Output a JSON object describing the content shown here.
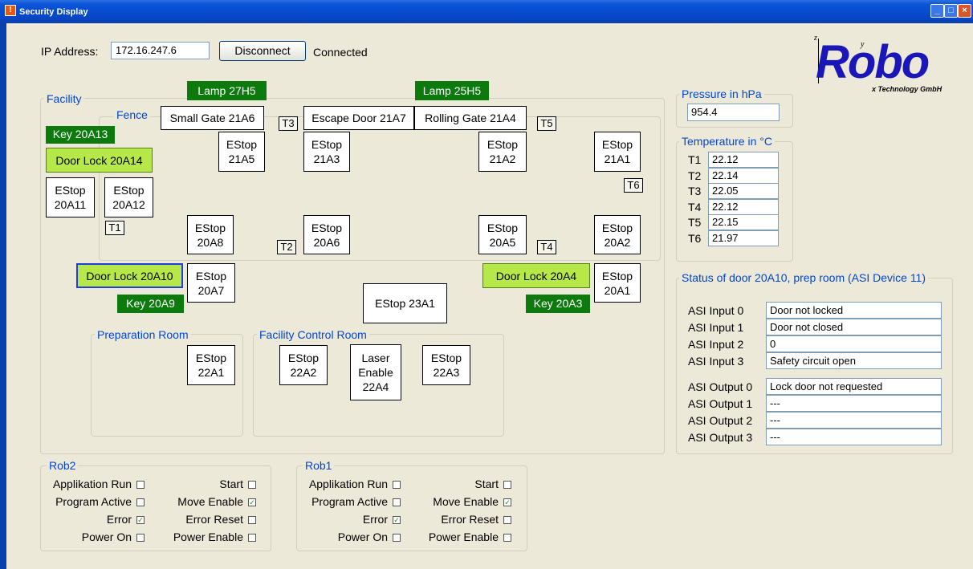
{
  "window": {
    "title": "Security Display",
    "app_icon": "warning-icon"
  },
  "connection": {
    "ip_label": "IP Address:",
    "ip_value": "172.16.247.6",
    "disconnect_label": "Disconnect",
    "status": "Connected"
  },
  "logo": {
    "brand": "Robo",
    "tagline": "x Technology GmbH",
    "axis_z": "z",
    "axis_y": "y"
  },
  "facility": {
    "label": "Facility",
    "fence_label": "Fence",
    "lamps": {
      "lamp_27h5": "Lamp 27H5",
      "lamp_25h5": "Lamp 25H5"
    },
    "gates": {
      "small_gate": "Small Gate 21A6",
      "escape_door": "Escape Door 21A7",
      "rolling_gate": "Rolling Gate 21A4"
    },
    "keys": {
      "key_20a13": "Key 20A13",
      "key_20a9": "Key 20A9",
      "key_20a3": "Key 20A3"
    },
    "door_locks": {
      "dl_20a14": "Door Lock 20A14",
      "dl_20a10": "Door Lock 20A10",
      "dl_20a4": "Door Lock 20A4"
    },
    "estops": {
      "e21a5": [
        "EStop",
        "21A5"
      ],
      "e21a3": [
        "EStop",
        "21A3"
      ],
      "e21a2": [
        "EStop",
        "21A2"
      ],
      "e21a1": [
        "EStop",
        "21A1"
      ],
      "e20a11": [
        "EStop",
        "20A11"
      ],
      "e20a12": [
        "EStop",
        "20A12"
      ],
      "e20a8": [
        "EStop",
        "20A8"
      ],
      "e20a6": [
        "EStop",
        "20A6"
      ],
      "e20a5": [
        "EStop",
        "20A5"
      ],
      "e20a2": [
        "EStop",
        "20A2"
      ],
      "e20a7": [
        "EStop",
        "20A7"
      ],
      "e20a1": [
        "EStop",
        "20A1"
      ],
      "e23a1": "EStop 23A1",
      "e22a1": [
        "EStop",
        "22A1"
      ],
      "e22a2": [
        "EStop",
        "22A2"
      ],
      "e22a3": [
        "EStop",
        "22A3"
      ]
    },
    "laser": [
      "Laser",
      "Enable",
      "22A4"
    ],
    "sensors": {
      "t1": "T1",
      "t2": "T2",
      "t3": "T3",
      "t4": "T4",
      "t5": "T5",
      "t6": "T6"
    },
    "prep_room_label": "Preparation Room",
    "control_room_label": "Facility Control Room"
  },
  "pressure": {
    "label": "Pressure in hPa",
    "value": "954.4"
  },
  "temperature": {
    "label": "Temperature in °C",
    "rows": [
      {
        "name": "T1",
        "value": "22.12"
      },
      {
        "name": "T2",
        "value": "22.14"
      },
      {
        "name": "T3",
        "value": "22.05"
      },
      {
        "name": "T4",
        "value": "22.12"
      },
      {
        "name": "T5",
        "value": "22.15"
      },
      {
        "name": "T6",
        "value": "21.97"
      }
    ]
  },
  "door_status": {
    "label": "Status of door 20A10, prep room (ASI Device 11)",
    "inputs": [
      {
        "name": "ASI Input 0",
        "value": "Door not locked"
      },
      {
        "name": "ASI Input 1",
        "value": "Door not closed"
      },
      {
        "name": "ASI Input 2",
        "value": "0"
      },
      {
        "name": "ASI Input 3",
        "value": "Safety circuit open"
      }
    ],
    "outputs": [
      {
        "name": "ASI Output 0",
        "value": "Lock door not requested"
      },
      {
        "name": "ASI Output 1",
        "value": "---"
      },
      {
        "name": "ASI Output 2",
        "value": "---"
      },
      {
        "name": "ASI Output 3",
        "value": "---"
      }
    ]
  },
  "rob2": {
    "label": "Rob2",
    "left": [
      {
        "label": "Applikation Run",
        "checked": false
      },
      {
        "label": "Program Active",
        "checked": false
      },
      {
        "label": "Error",
        "checked": true
      },
      {
        "label": "Power On",
        "checked": false
      }
    ],
    "right": [
      {
        "label": "Start",
        "checked": false
      },
      {
        "label": "Move Enable",
        "checked": true
      },
      {
        "label": "Error Reset",
        "checked": false
      },
      {
        "label": "Power Enable",
        "checked": false
      }
    ]
  },
  "rob1": {
    "label": "Rob1",
    "left": [
      {
        "label": "Applikation Run",
        "checked": false
      },
      {
        "label": "Program Active",
        "checked": false
      },
      {
        "label": "Error",
        "checked": true
      },
      {
        "label": "Power On",
        "checked": false
      }
    ],
    "right": [
      {
        "label": "Start",
        "checked": false
      },
      {
        "label": "Move Enable",
        "checked": true
      },
      {
        "label": "Error Reset",
        "checked": false
      },
      {
        "label": "Power Enable",
        "checked": false
      }
    ]
  }
}
